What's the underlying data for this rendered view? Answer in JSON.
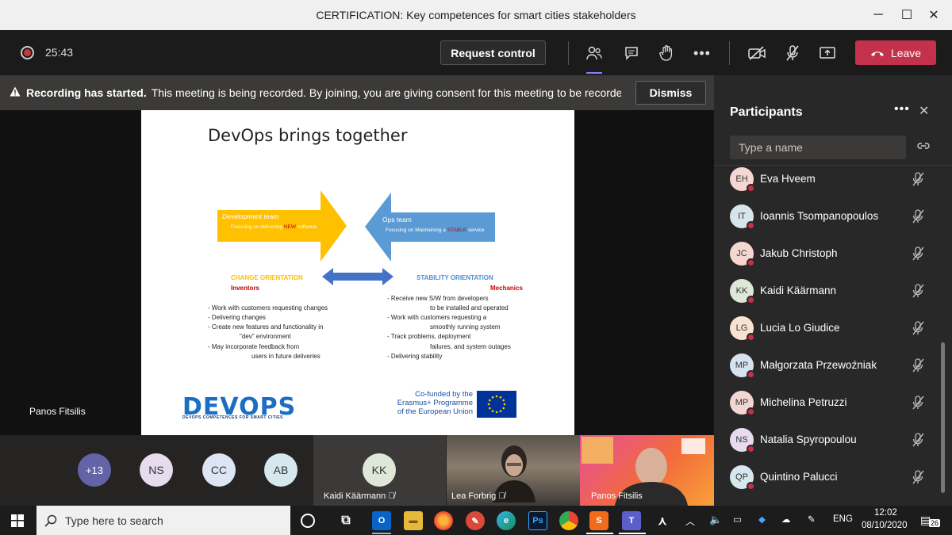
{
  "window": {
    "title": "CERTIFICATION: Key competences for smart cities stakeholders",
    "minimize": "─",
    "maximize": "☐",
    "close": "✕"
  },
  "toolbar": {
    "timer": "25:43",
    "request_control": "Request control",
    "leave": "Leave"
  },
  "banner": {
    "bold": "Recording has started.",
    "text": "This meeting is being recorded. By joining, you are giving consent for this meeting to be recorded. Privacy policy",
    "dismiss": "Dismiss"
  },
  "slide": {
    "title": "DevOps brings together",
    "dev_team": "Development team",
    "dev_focus_pre": "Focusing on delivering ",
    "dev_focus_hl": "NEW",
    "dev_focus_post": " software",
    "ops_team": "Ops team",
    "ops_focus_pre": "Focusing on Maintaining a ",
    "ops_focus_hl": "STABLE",
    "ops_focus_post": " service",
    "change_orientation": "CHANGE ORIENTATION",
    "inventors": "Inventors",
    "stability_orientation": "STABILITY ORIENTATION",
    "mechanics": "Mechanics",
    "left_bullets": [
      "-   Work with customers requesting changes",
      "-   Delivering changes",
      "-   Create new features and functionality in",
      "\"dev\" environment",
      "-   May incorporate feedback from",
      "users in future deliveries"
    ],
    "right_bullets": [
      "- Receive new S/W from developers",
      "to be installed and operated",
      "- Work with customers requesting a",
      "smoothly running system",
      "- Track problems, deployment",
      "failures, and system outages",
      "- Delivering stability"
    ],
    "logo": "DEVOPS",
    "logo_sub": "DEVOPS COMPETENCES FOR SMART CITIES",
    "eu_line1": "Co-funded by the",
    "eu_line2": "Erasmus+ Programme",
    "eu_line3": "of the European Union"
  },
  "stage": {
    "presenter": "Panos Fitsilis"
  },
  "strip": {
    "overflow": "+13",
    "avatars": [
      "NS",
      "CC",
      "AB"
    ],
    "kk_initials": "KK",
    "kk_name": "Kaidi Käärmann",
    "lea_name": "Lea Forbrig",
    "panos_name": "Panos Fitsilis"
  },
  "participants": {
    "title": "Participants",
    "search_placeholder": "Type a name",
    "list": [
      {
        "initials": "EH",
        "name": "Eva Hveem",
        "color": "#f4d6d2"
      },
      {
        "initials": "IT",
        "name": "Ioannis Tsompanopoulos",
        "color": "#d6e4ec"
      },
      {
        "initials": "JC",
        "name": "Jakub Christoph",
        "color": "#f6d7cf"
      },
      {
        "initials": "KK",
        "name": "Kaidi Käärmann",
        "color": "#dfe8d8"
      },
      {
        "initials": "LG",
        "name": "Lucia Lo Giudice",
        "color": "#f7e3cf"
      },
      {
        "initials": "MP",
        "name": "Małgorzata Przewoźniak",
        "color": "#d6e2ee"
      },
      {
        "initials": "MP",
        "name": "Michelina Petruzzi",
        "color": "#f2d6d2"
      },
      {
        "initials": "NS",
        "name": "Natalia Spyropoulou",
        "color": "#e6dcee"
      },
      {
        "initials": "QP",
        "name": "Quintino Palucci",
        "color": "#d6e8ee"
      }
    ]
  },
  "taskbar": {
    "search_text": "Type here to search",
    "lang": "ENG",
    "time": "12:02",
    "date": "08/10/2020",
    "notifications": "26"
  },
  "colors": {
    "accent": "#7f85f5",
    "leave": "#c4314b",
    "orange_arrow": "#ffc000",
    "blue_arrow": "#5b9bd5"
  }
}
